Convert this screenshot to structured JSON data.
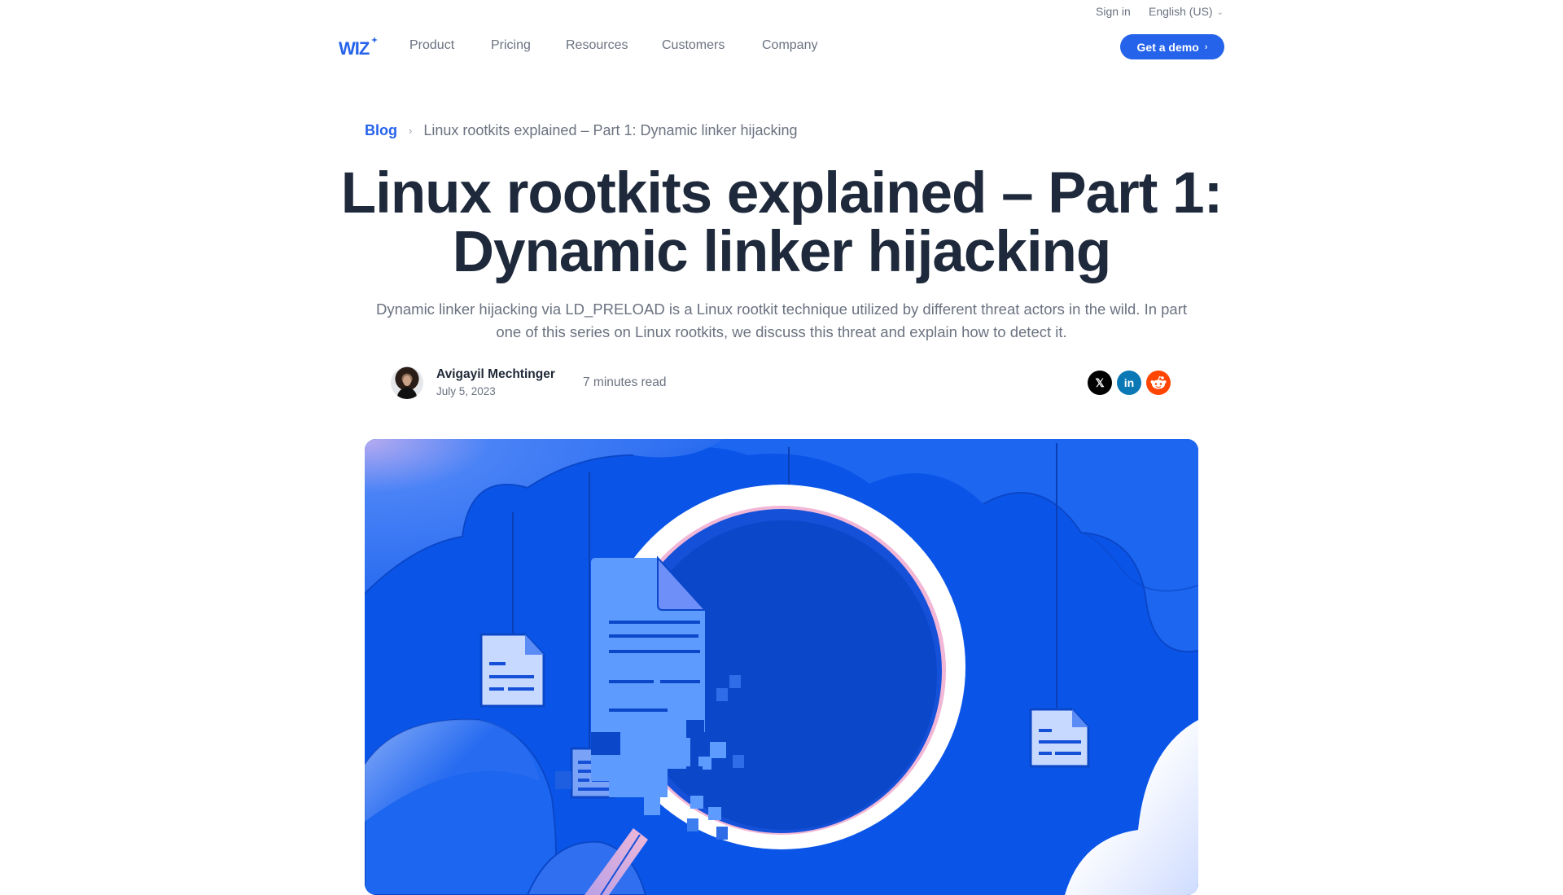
{
  "topbar": {
    "sign_in": "Sign in",
    "language": "English (US)"
  },
  "nav": {
    "logo": "WIZ",
    "items": [
      {
        "label": "Product"
      },
      {
        "label": "Pricing"
      },
      {
        "label": "Resources"
      },
      {
        "label": "Customers"
      },
      {
        "label": "Company"
      }
    ],
    "cta": "Get a demo"
  },
  "breadcrumb": {
    "root": "Blog",
    "current": "Linux rootkits explained – Part 1: Dynamic linker hijacking"
  },
  "article": {
    "title": "Linux rootkits explained – Part 1: Dynamic linker hijacking",
    "subtitle": "Dynamic linker hijacking via LD_PRELOAD is a Linux rootkit technique utilized by different threat actors in the wild. In part one of this series on Linux rootkits, we discuss this threat and explain how to detect it.",
    "author": "Avigayil Mechtinger",
    "date": "July 5, 2023",
    "read_time": "7 minutes read"
  },
  "share": [
    {
      "network": "x",
      "icon": "x-logo-icon",
      "glyph": "𝕏"
    },
    {
      "network": "linkedin",
      "icon": "linkedin-icon",
      "glyph": "in"
    },
    {
      "network": "reddit",
      "icon": "reddit-icon",
      "glyph": "●"
    }
  ],
  "colors": {
    "brand": "#2563eb",
    "title": "#1e293b",
    "muted": "#6b7280",
    "hero_bg": "#0a55e8",
    "x": "#000000",
    "linkedin": "#0a78b5",
    "reddit": "#ff4500"
  },
  "hero": {
    "alt_subject": "magnifying-glass-over-document-illustration"
  }
}
